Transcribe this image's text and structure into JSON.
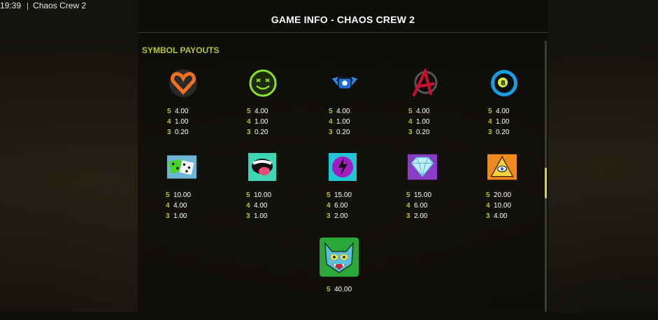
{
  "statusbar": {
    "time": "19:39",
    "app_title": "Chaos Crew 2"
  },
  "dialog": {
    "title": "GAME INFO - CHAOS CREW 2",
    "section": "SYMBOL PAYOUTS"
  },
  "symbols": [
    {
      "name": "heart-symbol",
      "pays": [
        {
          "n": "5",
          "v": "4.00"
        },
        {
          "n": "4",
          "v": "1.00"
        },
        {
          "n": "3",
          "v": "0.20"
        }
      ]
    },
    {
      "name": "smiley-symbol",
      "pays": [
        {
          "n": "5",
          "v": "4.00"
        },
        {
          "n": "4",
          "v": "1.00"
        },
        {
          "n": "3",
          "v": "0.20"
        }
      ]
    },
    {
      "name": "winged-cap-symbol",
      "pays": [
        {
          "n": "5",
          "v": "4.00"
        },
        {
          "n": "4",
          "v": "1.00"
        },
        {
          "n": "3",
          "v": "0.20"
        }
      ]
    },
    {
      "name": "anarchy-symbol",
      "pays": [
        {
          "n": "5",
          "v": "4.00"
        },
        {
          "n": "4",
          "v": "1.00"
        },
        {
          "n": "3",
          "v": "0.20"
        }
      ]
    },
    {
      "name": "eight-ball-symbol",
      "pays": [
        {
          "n": "5",
          "v": "4.00"
        },
        {
          "n": "4",
          "v": "1.00"
        },
        {
          "n": "3",
          "v": "0.20"
        }
      ]
    },
    {
      "name": "dice-symbol",
      "pays": [
        {
          "n": "5",
          "v": "10.00"
        },
        {
          "n": "4",
          "v": "4.00"
        },
        {
          "n": "3",
          "v": "1.00"
        }
      ]
    },
    {
      "name": "mouth-symbol",
      "pays": [
        {
          "n": "5",
          "v": "10.00"
        },
        {
          "n": "4",
          "v": "4.00"
        },
        {
          "n": "3",
          "v": "1.00"
        }
      ]
    },
    {
      "name": "face-bolt-symbol",
      "pays": [
        {
          "n": "5",
          "v": "15.00"
        },
        {
          "n": "4",
          "v": "6.00"
        },
        {
          "n": "3",
          "v": "2.00"
        }
      ]
    },
    {
      "name": "diamond-symbol",
      "pays": [
        {
          "n": "5",
          "v": "15.00"
        },
        {
          "n": "4",
          "v": "6.00"
        },
        {
          "n": "3",
          "v": "2.00"
        }
      ]
    },
    {
      "name": "pyramid-eye-symbol",
      "pays": [
        {
          "n": "5",
          "v": "20.00"
        },
        {
          "n": "4",
          "v": "10.00"
        },
        {
          "n": "3",
          "v": "4.00"
        }
      ]
    },
    {
      "name": "cat-wild-symbol",
      "pays": [
        {
          "n": "5",
          "v": "40.00"
        }
      ]
    }
  ],
  "colors": {
    "accent": "#b3c82a",
    "scroll_thumb": "#c6e02b",
    "title": "#ffffff"
  }
}
